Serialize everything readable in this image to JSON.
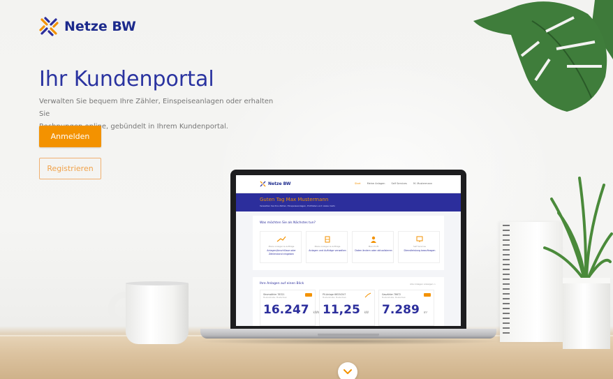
{
  "brand": {
    "name": "Netze BW"
  },
  "hero": {
    "title": "Ihr Kundenportal",
    "description_line1": "Verwalten Sie bequem Ihre Zähler, Einspeiseanlagen oder erhalten Sie",
    "description_line2": "Rechnungen online, gebündelt in Ihrem Kundenportal.",
    "login_label": "Anmelden",
    "register_label": "Registrieren"
  },
  "laptop_screen": {
    "brand": "Netze BW",
    "nav": [
      "Start",
      "Meine Anlagen",
      "Self Services",
      "M. Mustermann"
    ],
    "greeting": "Guten Tag Max Mustermann",
    "greeting_sub": "Verwalten Sie Ihre Zähler, Einspeiseanlagen, Prüfdaten und vieles mehr.",
    "question": "Was möchten Sie als Nächstes tun?",
    "tiles": [
      {
        "small": "Meine Anlagen & Aufträge",
        "label": "Anlagen/Anschlüsse oder Zählerstand eingeben",
        "icon": "plug-icon"
      },
      {
        "small": "Meine Anlagen & Aufträge",
        "label": "Anlagen und Aufträge verwalten",
        "icon": "building-icon"
      },
      {
        "small": "Mein Profil",
        "label": "Daten ändern oder aktualisieren",
        "icon": "user-icon"
      },
      {
        "small": "Self Services",
        "label": "Dienstleistung beauftragen",
        "icon": "monitor-icon"
      }
    ],
    "facilities_title": "Ihre Anlagen auf einen Blick",
    "facilities_link": "Alle Anlagen anzeigen >",
    "meters": [
      {
        "l1": "Stromzähler 78321",
        "l2": "Musterstraße, Mustertown",
        "value": "16.247",
        "unit": "kWh"
      },
      {
        "l1": "PV-Anlage 66534347",
        "l2": "Musterstraße, Mustertown",
        "value": "11,25",
        "unit": "kW"
      },
      {
        "l1": "Gaszähler 78672",
        "l2": "Musterstraße, Mustertown",
        "value": "7.289",
        "unit": "m³"
      }
    ]
  },
  "colors": {
    "brand_blue": "#2c2e9c",
    "brand_orange": "#f39200"
  }
}
